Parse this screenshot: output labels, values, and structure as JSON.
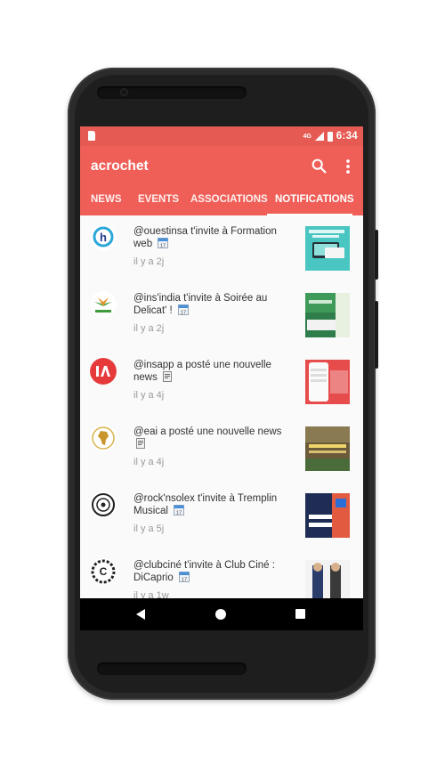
{
  "status_bar": {
    "network": "4G",
    "time": "6:34"
  },
  "app": {
    "title": "acrochet"
  },
  "tabs": [
    {
      "label": "NEWS",
      "active": false
    },
    {
      "label": "EVENTS",
      "active": false
    },
    {
      "label": "ASSOCIATIONS",
      "active": false
    },
    {
      "label": "NOTIFICATIONS",
      "active": true
    }
  ],
  "notifications": [
    {
      "text": "@ouestinsa t'invite à Formation web",
      "time": "il y a 2j",
      "badge": "calendar-icon"
    },
    {
      "text": "@ins'india t'invite à Soirée au Delicat' !",
      "time": "il y a 2j",
      "badge": "calendar-icon"
    },
    {
      "text": "@insapp a posté une nouvelle news",
      "time": "il y a 4j",
      "badge": "document-icon"
    },
    {
      "text": "@eai a posté une nouvelle news",
      "time": "il y a 4j",
      "badge": "document-icon"
    },
    {
      "text": "@rock'nsolex t'invite à Tremplin Musical",
      "time": "il y a 5j",
      "badge": "calendar-icon"
    },
    {
      "text": "@clubciné t'invite à Club Ciné : DiCaprio",
      "time": "il y a 1w",
      "badge": "calendar-icon"
    }
  ],
  "colors": {
    "status_bar": "#e65a54",
    "app_bar": "#ef5f58",
    "feed_bg": "#fafafa"
  }
}
